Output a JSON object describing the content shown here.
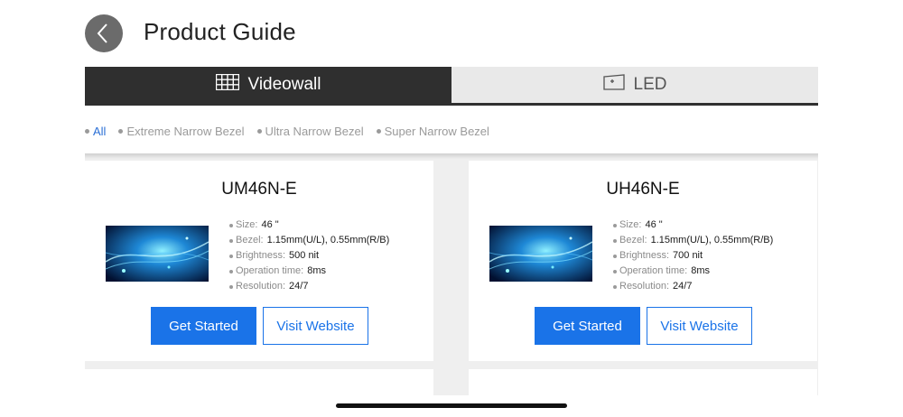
{
  "header": {
    "title": "Product Guide",
    "back_icon": "chevron-left-icon"
  },
  "tabs": [
    {
      "label": "Videowall",
      "icon": "grid-icon",
      "active": true
    },
    {
      "label": "LED",
      "icon": "led-screen-icon",
      "active": false
    }
  ],
  "filters": [
    {
      "label": "All",
      "active": true
    },
    {
      "label": "Extreme Narrow Bezel",
      "active": false
    },
    {
      "label": "Ultra Narrow Bezel",
      "active": false
    },
    {
      "label": "Super Narrow Bezel",
      "active": false
    }
  ],
  "colors": {
    "accent": "#1a73e8",
    "tab_dark": "#2f2f2f",
    "tab_light": "#e9e9e9"
  },
  "products": [
    {
      "title": "UM46N-E",
      "specs": [
        {
          "label": "Size:",
          "value": "46 \""
        },
        {
          "label": "Bezel:",
          "value": "1.15mm(U/L), 0.55mm(R/B)"
        },
        {
          "label": "Brightness:",
          "value": "500 nit"
        },
        {
          "label": "Operation time:",
          "value": "8ms"
        },
        {
          "label": "Resolution:",
          "value": "24/7"
        }
      ],
      "primary_button": "Get Started",
      "secondary_button": "Visit Website"
    },
    {
      "title": "UH46N-E",
      "specs": [
        {
          "label": "Size:",
          "value": "46 \""
        },
        {
          "label": "Bezel:",
          "value": "1.15mm(U/L), 0.55mm(R/B)"
        },
        {
          "label": "Brightness:",
          "value": "700 nit"
        },
        {
          "label": "Operation time:",
          "value": "8ms"
        },
        {
          "label": "Resolution:",
          "value": "24/7"
        }
      ],
      "primary_button": "Get Started",
      "secondary_button": "Visit Website"
    }
  ]
}
